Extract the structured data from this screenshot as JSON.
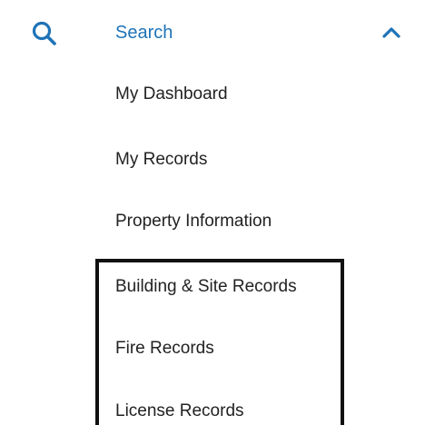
{
  "nav": {
    "search_label": "Search",
    "search_icon": "search-icon",
    "toggle_icon": "chevron-up-icon",
    "accent_color": "#1f73b7",
    "items": [
      {
        "label": "My Dashboard"
      },
      {
        "label": "My Records"
      },
      {
        "label": "Property Information"
      },
      {
        "label": "Building & Site Records"
      },
      {
        "label": "Fire Records"
      },
      {
        "label": "License Records"
      }
    ]
  }
}
